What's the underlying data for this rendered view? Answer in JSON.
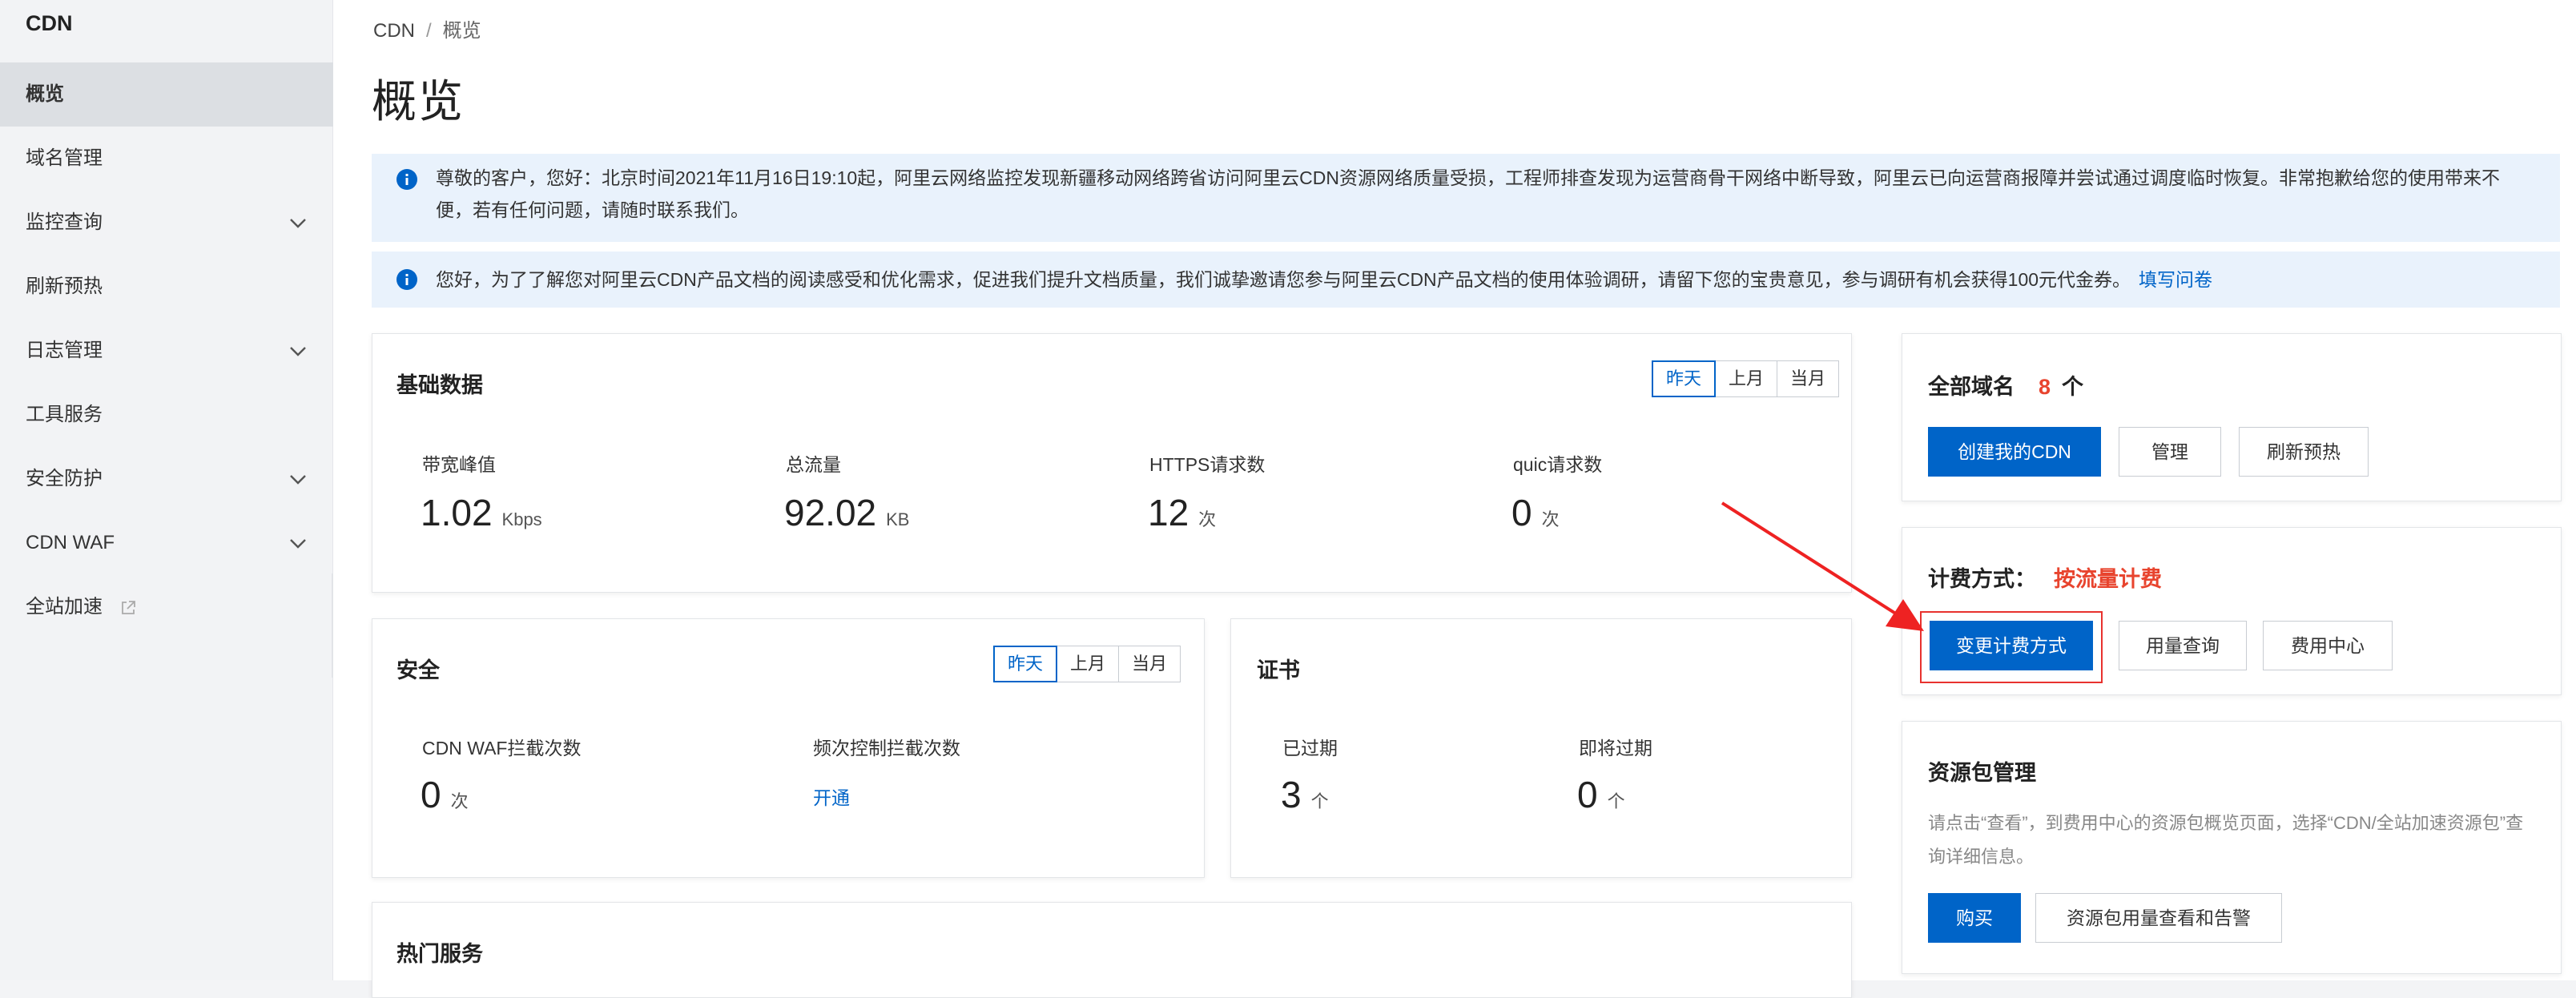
{
  "sidebar": {
    "title": "CDN",
    "items": [
      {
        "label": "概览"
      },
      {
        "label": "域名管理"
      },
      {
        "label": "监控查询"
      },
      {
        "label": "刷新预热"
      },
      {
        "label": "日志管理"
      },
      {
        "label": "工具服务"
      },
      {
        "label": "安全防护"
      },
      {
        "label": "CDN WAF"
      },
      {
        "label": "全站加速"
      }
    ]
  },
  "breadcrumb": {
    "root": "CDN",
    "separator": "/",
    "current": "概览"
  },
  "page_title": "概览",
  "notices": [
    {
      "text": "尊敬的客户，您好：北京时间2021年11月16日19:10起，阿里云网络监控发现新疆移动网络跨省访问阿里云CDN资源网络质量受损，工程师排查发现为运营商骨干网络中断导致，阿里云已向运营商报障并尝试通过调度临时恢复。非常抱歉给您的使用带来不便，若有任何问题，请随时联系我们。"
    },
    {
      "text": "您好，为了了解您对阿里云CDN产品文档的阅读感受和优化需求，促进我们提升文档质量，我们诚挚邀请您参与阿里云CDN产品文档的使用体验调研，请留下您的宝贵意见，参与调研有机会获得100元代金券。",
      "link": "填写问卷"
    }
  ],
  "basic": {
    "title": "基础数据",
    "periods": [
      "昨天",
      "上月",
      "当月"
    ],
    "metrics": [
      {
        "label": "带宽峰值",
        "value": "1.02",
        "unit": "Kbps"
      },
      {
        "label": "总流量",
        "value": "92.02",
        "unit": "KB"
      },
      {
        "label": "HTTPS请求数",
        "value": "12",
        "unit": "次"
      },
      {
        "label": "quic请求数",
        "value": "0",
        "unit": "次"
      }
    ]
  },
  "security": {
    "title": "安全",
    "periods": [
      "昨天",
      "上月",
      "当月"
    ],
    "waf_label": "CDN WAF拦截次数",
    "waf_value": "0",
    "waf_unit": "次",
    "freq_label": "频次控制拦截次数",
    "freq_link": "开通"
  },
  "cert": {
    "title": "证书",
    "expired_label": "已过期",
    "expired_value": "3",
    "expiring_label": "即将过期",
    "expiring_value": "0",
    "unit": "个"
  },
  "hot": {
    "title": "热门服务"
  },
  "domains": {
    "label": "全部域名",
    "count": "8",
    "unit": "个",
    "create_btn": "创建我的CDN",
    "manage_btn": "管理",
    "refresh_btn": "刷新预热"
  },
  "billing": {
    "label": "计费方式：",
    "value": "按流量计费",
    "change_btn": "变更计费方式",
    "usage_btn": "用量查询",
    "cost_btn": "费用中心"
  },
  "package": {
    "title": "资源包管理",
    "desc": "请点击“查看”，到费用中心的资源包概览页面，选择“CDN/全站加速资源包”查询详细信息。",
    "buy_btn": "购买",
    "alert_btn": "资源包用量查看和告警"
  },
  "colors": {
    "primary": "#0064c8",
    "accent_red": "#e8442e",
    "notice_bg": "#e9f2fc"
  }
}
